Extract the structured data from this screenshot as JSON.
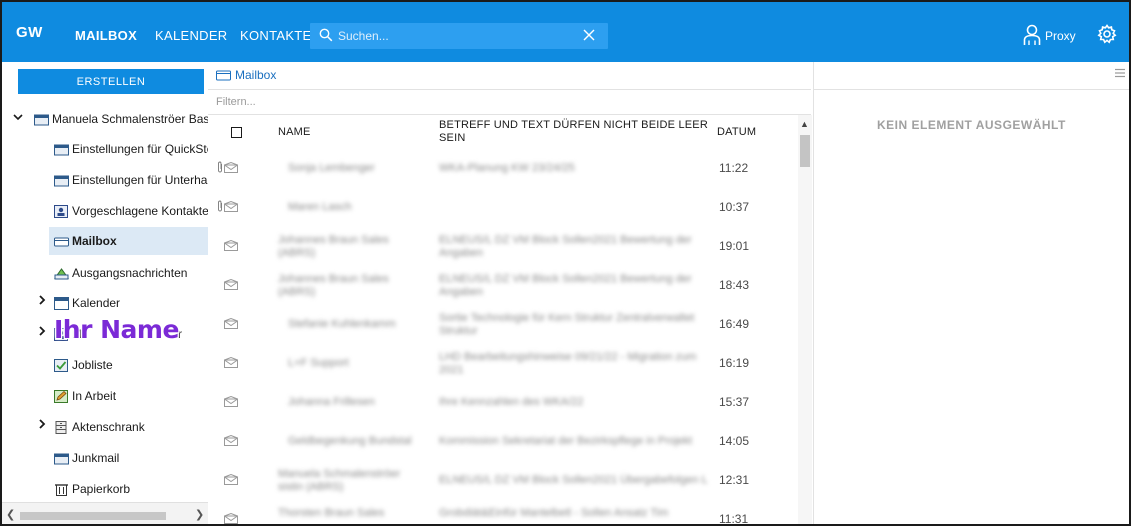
{
  "app": {
    "logo": "GW"
  },
  "nav": {
    "mailbox": "MAILBOX",
    "kalender": "KALENDER",
    "kontakte": "KONTAKTE"
  },
  "search": {
    "placeholder": "Suchen..."
  },
  "header": {
    "proxy_label": "Proxy"
  },
  "sidebar": {
    "create_label": "ERSTELLEN",
    "root": "Manuela Schmalenströer Basisc",
    "items": [
      {
        "label": "Einstellungen für QuickStep",
        "icon": "folder-icon"
      },
      {
        "label": "Einstellungen für Unterhalt",
        "icon": "folder-icon"
      },
      {
        "label": "Vorgeschlagene Kontakte",
        "icon": "contacts-icon"
      },
      {
        "label": "Mailbox",
        "icon": "mailbox-icon"
      },
      {
        "label": "Ausgangsnachrichten",
        "icon": "outbox-icon"
      },
      {
        "label": "Kalender",
        "icon": "calendar-icon"
      },
      {
        "label": "M",
        "suffix": "r",
        "icon": "contacts-icon"
      },
      {
        "label": "Jobliste",
        "icon": "checklist-icon"
      },
      {
        "label": "In Arbeit",
        "icon": "edit-icon"
      },
      {
        "label": "Aktenschrank",
        "icon": "cabinet-icon"
      },
      {
        "label": "Junkmail",
        "icon": "folder-icon"
      },
      {
        "label": "Papierkorb",
        "icon": "trash-icon"
      }
    ],
    "watermark": "Ihr Name"
  },
  "list": {
    "breadcrumb": "Mailbox",
    "filter_placeholder": "Filtern...",
    "columns": {
      "name": "NAME",
      "subject": "BETREFF UND TEXT DÜRFEN NICHT BEIDE LEER SEIN",
      "date": "DATUM"
    },
    "rows": [
      {
        "name": "Sonja Lembenger",
        "subject": "WKA-Planung KW 23/24/25",
        "date": "11:22",
        "attachment": true
      },
      {
        "name": "Maren Lasch",
        "subject": "",
        "date": "10:37",
        "attachment": true
      },
      {
        "name": "Johannes Braun Sales (ABRS)",
        "subject": "ELNEUS/L DZ VM Block Sollen2021 Bewertung der Angaben",
        "date": "19:01",
        "attachment": false
      },
      {
        "name": "Johannes Braun Sales (ABRS)",
        "subject": "ELNEUS/L DZ VM Block Sollen2021 Bewertung der Angaben",
        "date": "18:43",
        "attachment": false
      },
      {
        "name": "Stefanie Kuhlenkamm",
        "subject": "Sortie Technologie für Kern Struktur Zentralverwaltet Struktur",
        "date": "16:49",
        "attachment": false
      },
      {
        "name": "L+F Support",
        "subject": "LHD Bearbeitungshinweise 09/21/22 - Migration zum 2021",
        "date": "16:19",
        "attachment": false
      },
      {
        "name": "Johanna Frillesen",
        "subject": "Ihre Kennzahlen des WKA/22",
        "date": "15:37",
        "attachment": false
      },
      {
        "name": "Geldbegenkung Bundstal",
        "subject": "Kommission Sekretariat der Bezirkspflege in Projekt",
        "date": "14:05",
        "attachment": false
      },
      {
        "name": "Manuela Schmalenströer sistin (ABRS)",
        "subject": "ELNEUS/L DZ VM Block Sollen2021 Übergabefolgen L",
        "date": "12:31",
        "attachment": false
      },
      {
        "name": "Thorsten Braun Sales",
        "subject": "Grobdiät&Einfür Mantelbetl - Sollen Ansatz Tim",
        "date": "11:31",
        "attachment": false
      }
    ]
  },
  "preview": {
    "empty_message": "KEIN ELEMENT AUSGEWÄHLT"
  }
}
